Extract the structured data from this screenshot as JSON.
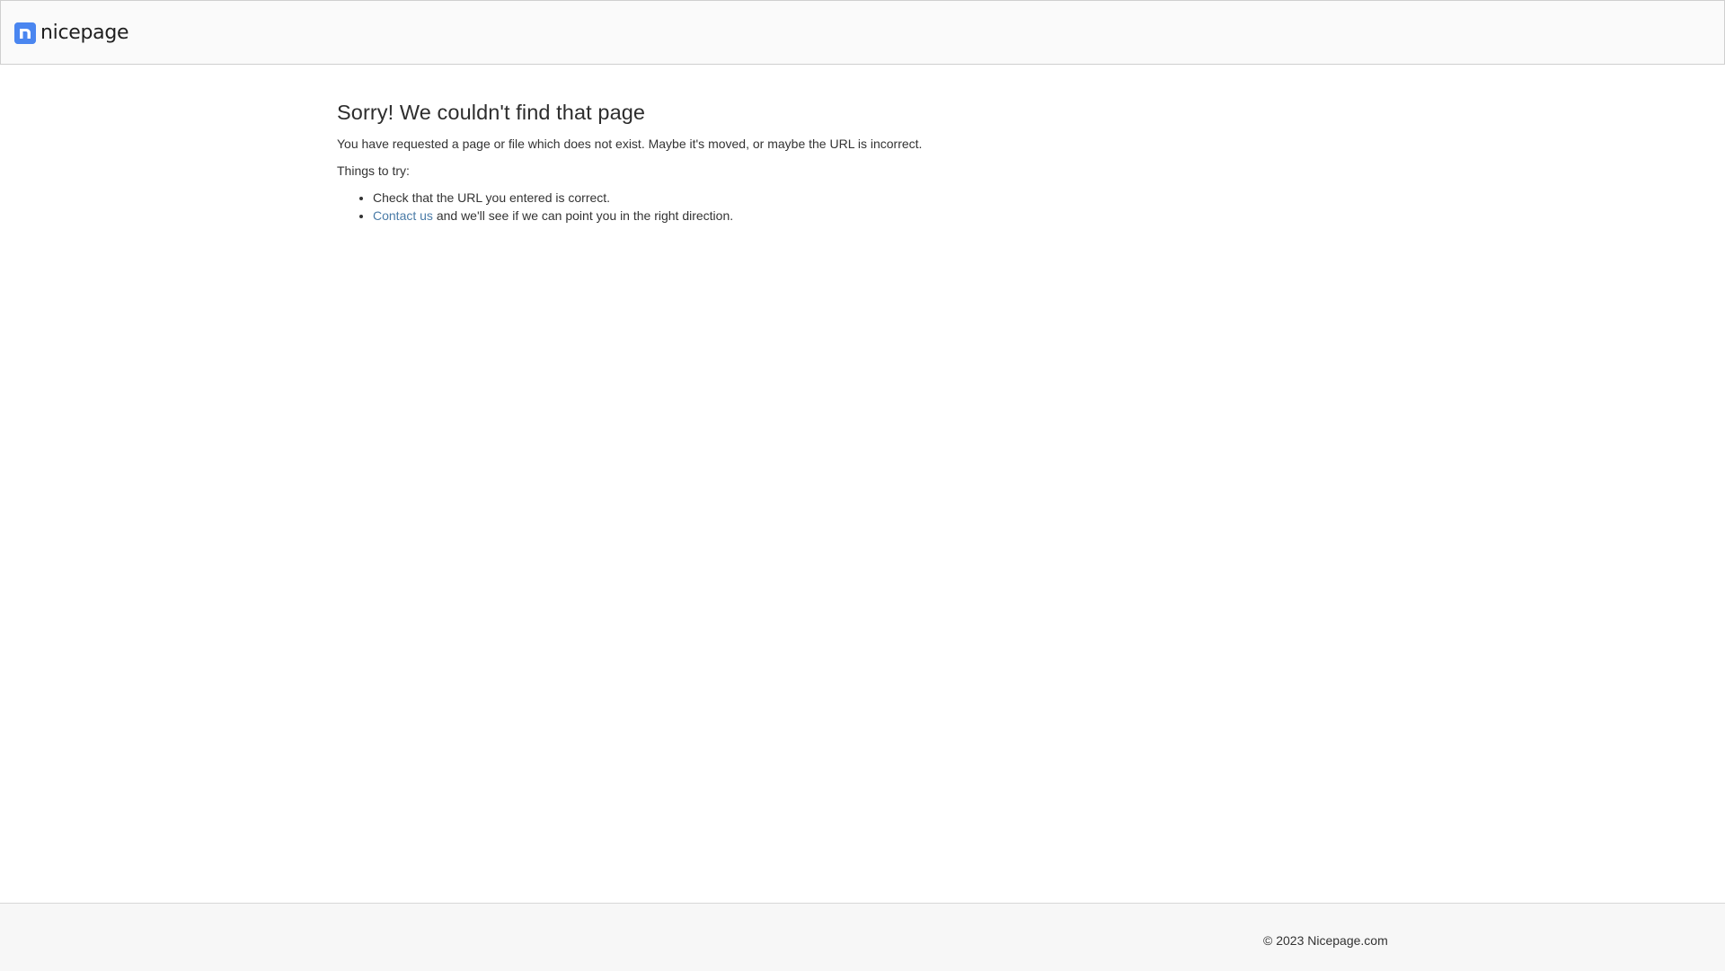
{
  "header": {
    "logo_text": "nicepage",
    "logo_icon": "n-logo-icon",
    "brand_color": "#4a86f0"
  },
  "main": {
    "title": "Sorry! We couldn't find that page",
    "description": "You have requested a page or file which does not exist. Maybe it's moved, or maybe the URL is incorrect.",
    "things_to_try": "Things to try:",
    "items": [
      {
        "text": "Check that the URL you entered is correct."
      },
      {
        "link": "Contact us",
        "text": " and we'll see if we can point you in the right direction."
      }
    ],
    "link_color": "#4a7ba7"
  },
  "footer": {
    "copyright": "© 2023 Nicepage.com"
  }
}
